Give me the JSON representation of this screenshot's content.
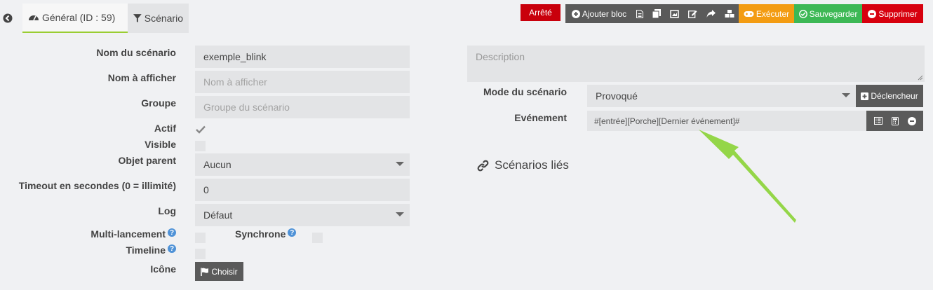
{
  "tabs": {
    "general_label": "Général (ID : 59)",
    "scenario_label": "Scénario"
  },
  "toolbar": {
    "state_label": "Arrêté",
    "add_block_label": "Ajouter bloc",
    "execute_label": "Exécuter",
    "save_label": "Sauvegarder",
    "delete_label": "Supprimer"
  },
  "form": {
    "name_label": "Nom du scénario",
    "name_value": "exemple_blink",
    "display_name_label": "Nom à afficher",
    "display_name_placeholder": "Nom à afficher",
    "group_label": "Groupe",
    "group_placeholder": "Groupe du scénario",
    "active_label": "Actif",
    "active_checked": true,
    "visible_label": "Visible",
    "visible_checked": false,
    "parent_label": "Objet parent",
    "parent_value": "Aucun",
    "timeout_label": "Timeout en secondes (0 = illimité)",
    "timeout_value": "0",
    "log_label": "Log",
    "log_value": "Défaut",
    "multilaunch_label": "Multi-lancement",
    "sync_label": "Synchrone",
    "timeline_label": "Timeline",
    "icon_label": "Icône",
    "choose_label": "Choisir",
    "help_glyph": "?"
  },
  "right": {
    "description_placeholder": "Description",
    "mode_label": "Mode du scénario",
    "mode_value": "Provoqué",
    "trigger_button_label": "Déclencheur",
    "event_label": "Evénement",
    "event_value": "#[entrée][Porche][Dernier événement]#",
    "linked_title": "Scénarios liés"
  },
  "colors": {
    "stopped": "#c9000c",
    "execute": "#f39c12",
    "save": "#3db855",
    "delete": "#d7000e",
    "toolbar_grey": "#5a5a5a",
    "active_tab_underline": "#9acd32",
    "annotation_arrow": "#8cd43a"
  },
  "icons": {
    "back": "circle-arrow-left-icon",
    "general": "gauge-icon",
    "scenario": "filter-icon",
    "add": "plus-circle-icon",
    "log": "file-icon",
    "copy": "copy-icon",
    "image": "image-icon",
    "edit": "edit-icon",
    "export": "share-icon",
    "template": "cubes-icon",
    "execute": "gamepad-icon",
    "save": "check-circle-icon",
    "delete": "minus-circle-icon",
    "choose": "flag-icon",
    "linked": "link-icon"
  }
}
